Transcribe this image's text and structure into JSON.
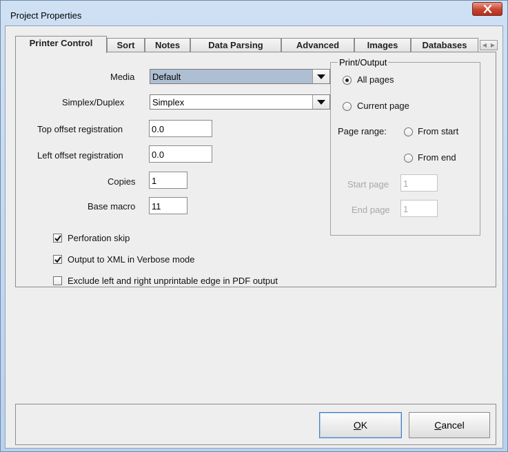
{
  "window": {
    "title": "Project Properties"
  },
  "tabs": [
    {
      "label": "Printer Control"
    },
    {
      "label": "Sort"
    },
    {
      "label": "Notes"
    },
    {
      "label": "Data Parsing"
    },
    {
      "label": "Advanced"
    },
    {
      "label": "Images"
    },
    {
      "label": "Databases"
    }
  ],
  "active_tab": "Printer Control",
  "form": {
    "media": {
      "label": "Media",
      "value": "Default"
    },
    "duplex": {
      "label": "Simplex/Duplex",
      "value": "Simplex"
    },
    "top_offset": {
      "label": "Top offset registration",
      "value": "0.0"
    },
    "left_offset": {
      "label": "Left offset registration",
      "value": "0.0"
    },
    "copies": {
      "label": "Copies",
      "value": "1"
    },
    "base_macro": {
      "label": "Base macro",
      "value": "11"
    }
  },
  "checkboxes": [
    {
      "label": "Perforation skip",
      "checked": true
    },
    {
      "label": "Output to XML in Verbose mode",
      "checked": true
    },
    {
      "label": "Exclude left and right unprintable edge in PDF output",
      "checked": false
    }
  ],
  "print_output": {
    "title": "Print/Output",
    "all_pages": "All pages",
    "current_page": "Current page",
    "page_range_label": "Page range:",
    "from_start": "From start",
    "from_end": "From end",
    "start_page_label": "Start page",
    "start_page_value": "1",
    "end_page_label": "End page",
    "end_page_value": "1"
  },
  "buttons": {
    "ok": {
      "mnemonic": "O",
      "rest": "K"
    },
    "cancel": {
      "mnemonic": "C",
      "rest": "ancel"
    }
  },
  "colors": {
    "combo_media_bg": "#aebfd3",
    "combo_duplex_bg": "#ffffff",
    "default_button_border": "#4a7dbf",
    "close_button": "#c7442f"
  }
}
